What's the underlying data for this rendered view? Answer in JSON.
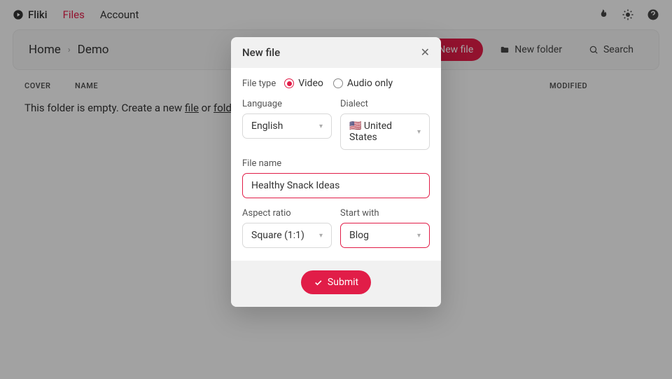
{
  "nav": {
    "brand": "Fliki",
    "files": "Files",
    "account": "Account"
  },
  "breadcrumb": {
    "home": "Home",
    "current": "Demo"
  },
  "toolbar": {
    "newFile": "New file",
    "newFolder": "New folder",
    "search": "Search"
  },
  "table": {
    "cover": "COVER",
    "name": "NAME",
    "modified": "MODIFIED"
  },
  "empty": {
    "prefix": "This folder is empty. Create a new ",
    "file": "file",
    "or": " or ",
    "folder": "folder",
    "suffix": "."
  },
  "modal": {
    "title": "New file",
    "fileType": {
      "label": "File type",
      "video": "Video",
      "audio": "Audio only"
    },
    "language": {
      "label": "Language",
      "value": "English"
    },
    "dialect": {
      "label": "Dialect",
      "value": "🇺🇸 United States"
    },
    "fileName": {
      "label": "File name",
      "value": "Healthy Snack Ideas"
    },
    "aspectRatio": {
      "label": "Aspect ratio",
      "value": "Square (1:1)"
    },
    "startWith": {
      "label": "Start with",
      "value": "Blog"
    },
    "submit": "Submit"
  }
}
